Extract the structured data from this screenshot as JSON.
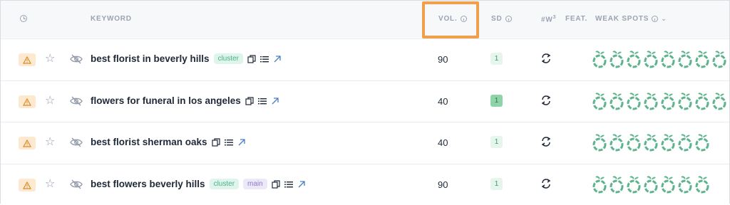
{
  "header": {
    "keyword": "KEYWORD",
    "vol": "VOL.",
    "sd": "SD",
    "w": "#W",
    "w_sup": "3",
    "feat": "FEAT.",
    "weak_spots": "WEAK SPOTS"
  },
  "rows": [
    {
      "keyword": "best florist in beverly hills",
      "tags": [
        "cluster"
      ],
      "vol": "90",
      "sd": "1",
      "sd_level": "light",
      "weak_spots": 8
    },
    {
      "keyword": "flowers for funeral in los angeles",
      "tags": [],
      "vol": "40",
      "sd": "1",
      "sd_level": "dark",
      "weak_spots": 8
    },
    {
      "keyword": "best florist sherman oaks",
      "tags": [],
      "vol": "40",
      "sd": "1",
      "sd_level": "light",
      "weak_spots": 7
    },
    {
      "keyword": "best flowers beverly hills",
      "tags": [
        "cluster",
        "main"
      ],
      "vol": "90",
      "sd": "1",
      "sd_level": "light",
      "weak_spots": 7
    }
  ],
  "colors": {
    "highlight": "#f0a04b",
    "weak_spot": "#5db48c",
    "warn_bg": "#fde9cf",
    "sd_light": "#e6f6ee",
    "sd_dark": "#8fd3a8"
  }
}
